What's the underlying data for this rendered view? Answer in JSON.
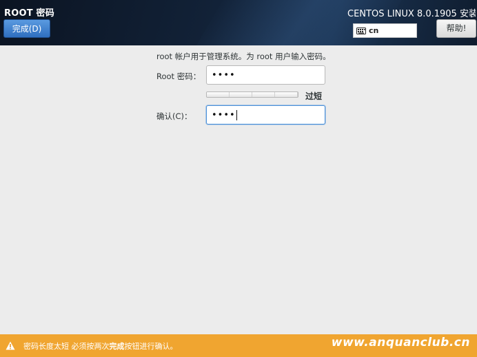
{
  "header": {
    "title": "ROOT 密码",
    "done_label": "完成(D)",
    "product": "CENTOS LINUX 8.0.1905 安装",
    "keyboard_layout": "cn",
    "help_label": "帮助!"
  },
  "form": {
    "instructions": "root 帐户用于管理系统。为 root 用户输入密码。",
    "password_label": "Root 密码：",
    "password_value": "••••",
    "confirm_label": "确认(C)：",
    "confirm_value": "••••",
    "strength_label": "过短",
    "strength_level": 0
  },
  "status_bar": {
    "message_prefix": "密码长度太短 必须按两次",
    "message_bold": "完成",
    "message_suffix": "按钮进行确认。",
    "watermark": "www.anquanclub.cn",
    "color": "#f0a530"
  },
  "icons": [
    "keyboard-icon",
    "warning-icon"
  ]
}
